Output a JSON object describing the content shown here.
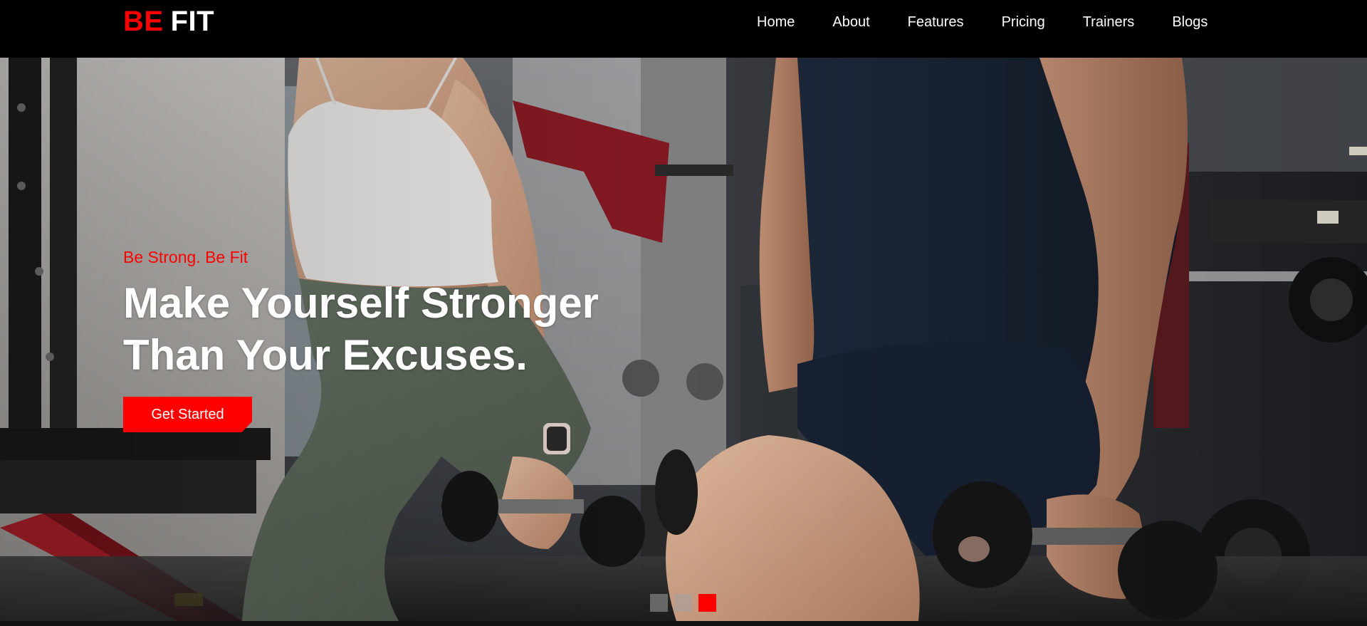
{
  "brand": {
    "part1": "BE",
    "part2": "FIT",
    "accent_color": "#ff0000"
  },
  "nav": {
    "items": [
      {
        "label": "Home"
      },
      {
        "label": "About"
      },
      {
        "label": "Features"
      },
      {
        "label": "Pricing"
      },
      {
        "label": "Trainers"
      },
      {
        "label": "Blogs"
      }
    ]
  },
  "hero": {
    "background_image": "gym-photo-two-people-lunging-with-dumbbells",
    "tagline": "Be Strong. Be Fit",
    "headline_line1": "Make Yourself Stronger",
    "headline_line2": "Than Your Excuses.",
    "cta_label": "Get Started"
  },
  "carousel": {
    "slide_count": 3,
    "active_index": 2
  }
}
